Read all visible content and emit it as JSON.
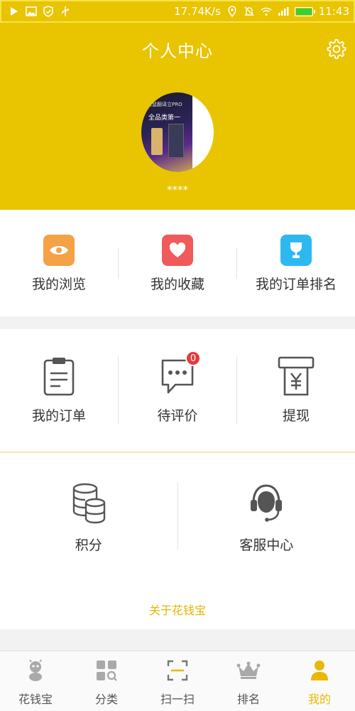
{
  "status_bar": {
    "network_speed": "17.74K/s",
    "time": "11:43",
    "battery_level": 1.0
  },
  "header": {
    "title": "个人中心"
  },
  "profile": {
    "username": "****"
  },
  "quick_links": [
    {
      "label": "我的浏览",
      "icon": "eye-icon",
      "color": "#f5a146"
    },
    {
      "label": "我的收藏",
      "icon": "heart-icon",
      "color": "#f05a5a"
    },
    {
      "label": "我的订单排名",
      "icon": "trophy-icon",
      "color": "#2eb8f0"
    }
  ],
  "order_links": [
    {
      "label": "我的订单",
      "icon": "clipboard-icon"
    },
    {
      "label": "待评价",
      "icon": "comment-icon",
      "badge": "0"
    },
    {
      "label": "提现",
      "icon": "withdraw-icon"
    }
  ],
  "service_links": [
    {
      "label": "积分",
      "icon": "coins-icon"
    },
    {
      "label": "客服中心",
      "icon": "headset-icon"
    }
  ],
  "about": {
    "label": "关于花钱宝"
  },
  "bottom_nav": [
    {
      "label": "花钱宝",
      "icon": "mascot-icon"
    },
    {
      "label": "分类",
      "icon": "category-icon"
    },
    {
      "label": "扫一扫",
      "icon": "scan-icon"
    },
    {
      "label": "排名",
      "icon": "crown-icon"
    },
    {
      "label": "我的",
      "icon": "user-icon",
      "active": true
    }
  ],
  "colors": {
    "brand": "#e9c400",
    "accent_text": "#e2b700",
    "badge": "#e43b3b"
  }
}
